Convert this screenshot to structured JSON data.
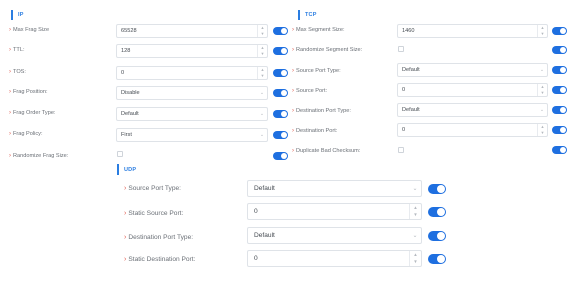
{
  "ip": {
    "title": "IP",
    "rows": [
      {
        "label": "Max Frag Size",
        "value": "65528",
        "type": "spinner"
      },
      {
        "label": "TTL:",
        "value": "128",
        "type": "spinner"
      },
      {
        "label": "TOS:",
        "value": "0",
        "type": "spinner"
      },
      {
        "label": "Frag Position:",
        "value": "Disable",
        "type": "select"
      },
      {
        "label": "Frag Order Type:",
        "value": "Default",
        "type": "select"
      },
      {
        "label": "Frag Policy:",
        "value": "First",
        "type": "select"
      },
      {
        "label": "Randomize Frag Size:",
        "value": "",
        "type": "checkbox"
      }
    ]
  },
  "tcp": {
    "title": "TCP",
    "rows": [
      {
        "label": "Max Segment Size:",
        "value": "1460",
        "type": "spinner"
      },
      {
        "label": "Randomize Segment Size:",
        "value": "",
        "type": "checkbox"
      },
      {
        "label": "Source Port Type:",
        "value": "Default",
        "type": "select"
      },
      {
        "label": "Source Port:",
        "value": "0",
        "type": "spinner"
      },
      {
        "label": "Destination Port Type:",
        "value": "Default",
        "type": "select"
      },
      {
        "label": "Destination Port:",
        "value": "0",
        "type": "spinner"
      },
      {
        "label": "Duplicate Bad Checksum:",
        "value": "",
        "type": "checkbox"
      }
    ]
  },
  "udp": {
    "title": "UDP",
    "rows": [
      {
        "label": "Source Port Type:",
        "value": "Default",
        "type": "select"
      },
      {
        "label": "Static Source Port:",
        "value": "0",
        "type": "spinner"
      },
      {
        "label": "Destination Port Type:",
        "value": "Default",
        "type": "select"
      },
      {
        "label": "Static Destination Port:",
        "value": "0",
        "type": "spinner"
      }
    ]
  },
  "icons": {
    "label_marker": "chevron-right-icon",
    "spin_up": "arrow-up-icon",
    "spin_down": "arrow-down-icon",
    "dropdown": "chevron-down-icon"
  },
  "colors": {
    "accent": "#2a7de1",
    "toggle_on": "#1e6fe0",
    "required_marker": "#e05a4e"
  }
}
